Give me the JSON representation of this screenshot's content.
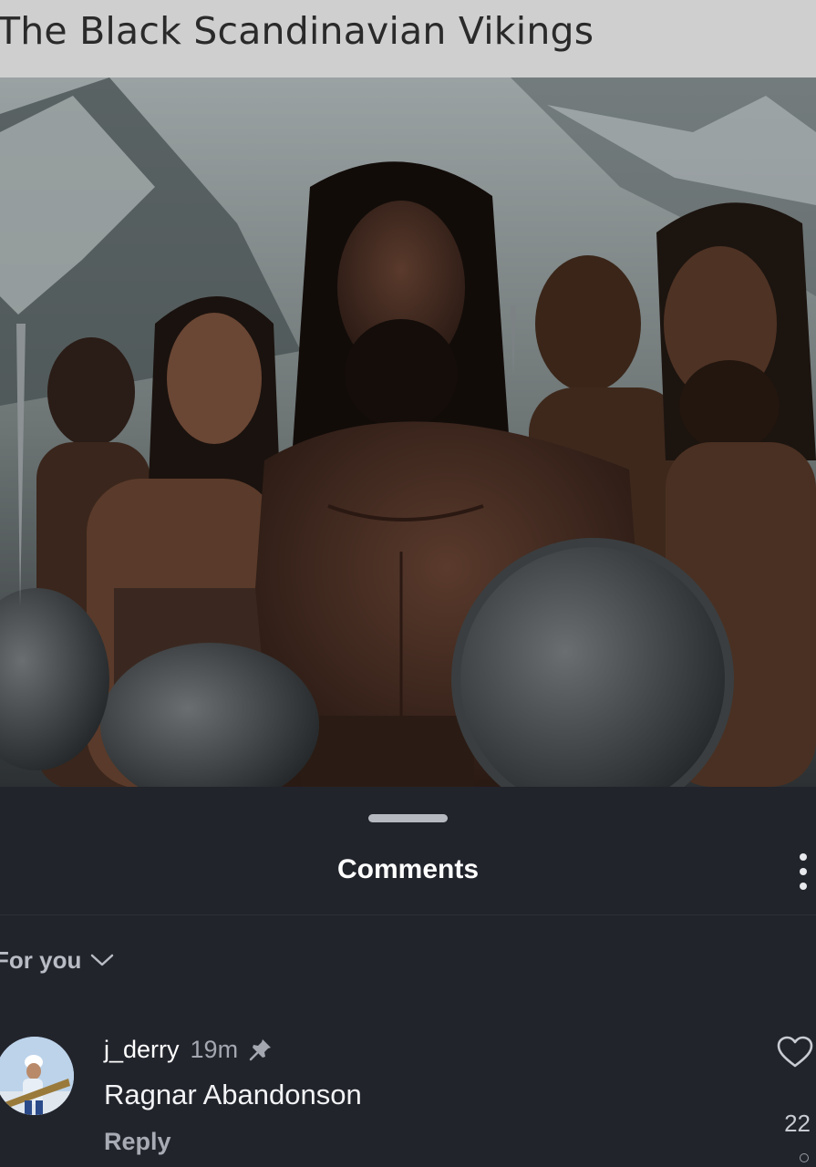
{
  "post": {
    "title": "The Black Scandinavian Vikings"
  },
  "comments_sheet": {
    "title": "Comments",
    "more_icon": "more-vertical-icon",
    "sort_label": "For you",
    "sort_icon": "chevron-down-icon"
  },
  "comments": [
    {
      "username": "j_derry",
      "time": "19m",
      "pinned": true,
      "text": "Ragnar Abandonson",
      "reply_label": "Reply",
      "likes": "22"
    }
  ],
  "colors": {
    "sheet_background": "#22242c",
    "title_bar": "#cfcfcf",
    "text_primary": "#ffffff",
    "text_secondary": "#a4a7b0"
  }
}
